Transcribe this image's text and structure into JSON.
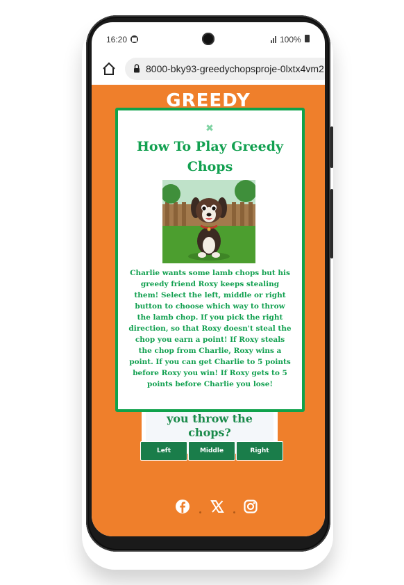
{
  "status_bar": {
    "time": "16:20",
    "battery": "100%"
  },
  "browser": {
    "url": "8000-bky93-greedychopsproje-0lxtx4vm2"
  },
  "header": {
    "brand": "GREEDY"
  },
  "question": {
    "text": "you throw the chops?"
  },
  "choices": [
    {
      "label": "Left"
    },
    {
      "label": "Middle"
    },
    {
      "label": "Right"
    }
  ],
  "socials": [
    {
      "icon": "facebook-icon"
    },
    {
      "icon": "x-icon"
    },
    {
      "icon": "instagram-icon"
    }
  ],
  "modal": {
    "close_glyph": "✖",
    "title": "How To Play Greedy Chops",
    "body": "Charlie wants some lamb chops but his greedy friend Roxy keeps stealing them! Select the left, middle or right button to choose which way to throw the lamb chop. If you pick the right direction, so that Roxy doesn't steal the chop you earn a point! If Roxy steals the chop from Charlie, Roxy wins a point. If you can get Charlie to 5 points before Roxy you win! If Roxy gets to 5 points before Charlie you lose!"
  },
  "colors": {
    "page_background": "#ef7f2b",
    "accent_green": "#12a050",
    "button_green": "#1a7d4a"
  }
}
